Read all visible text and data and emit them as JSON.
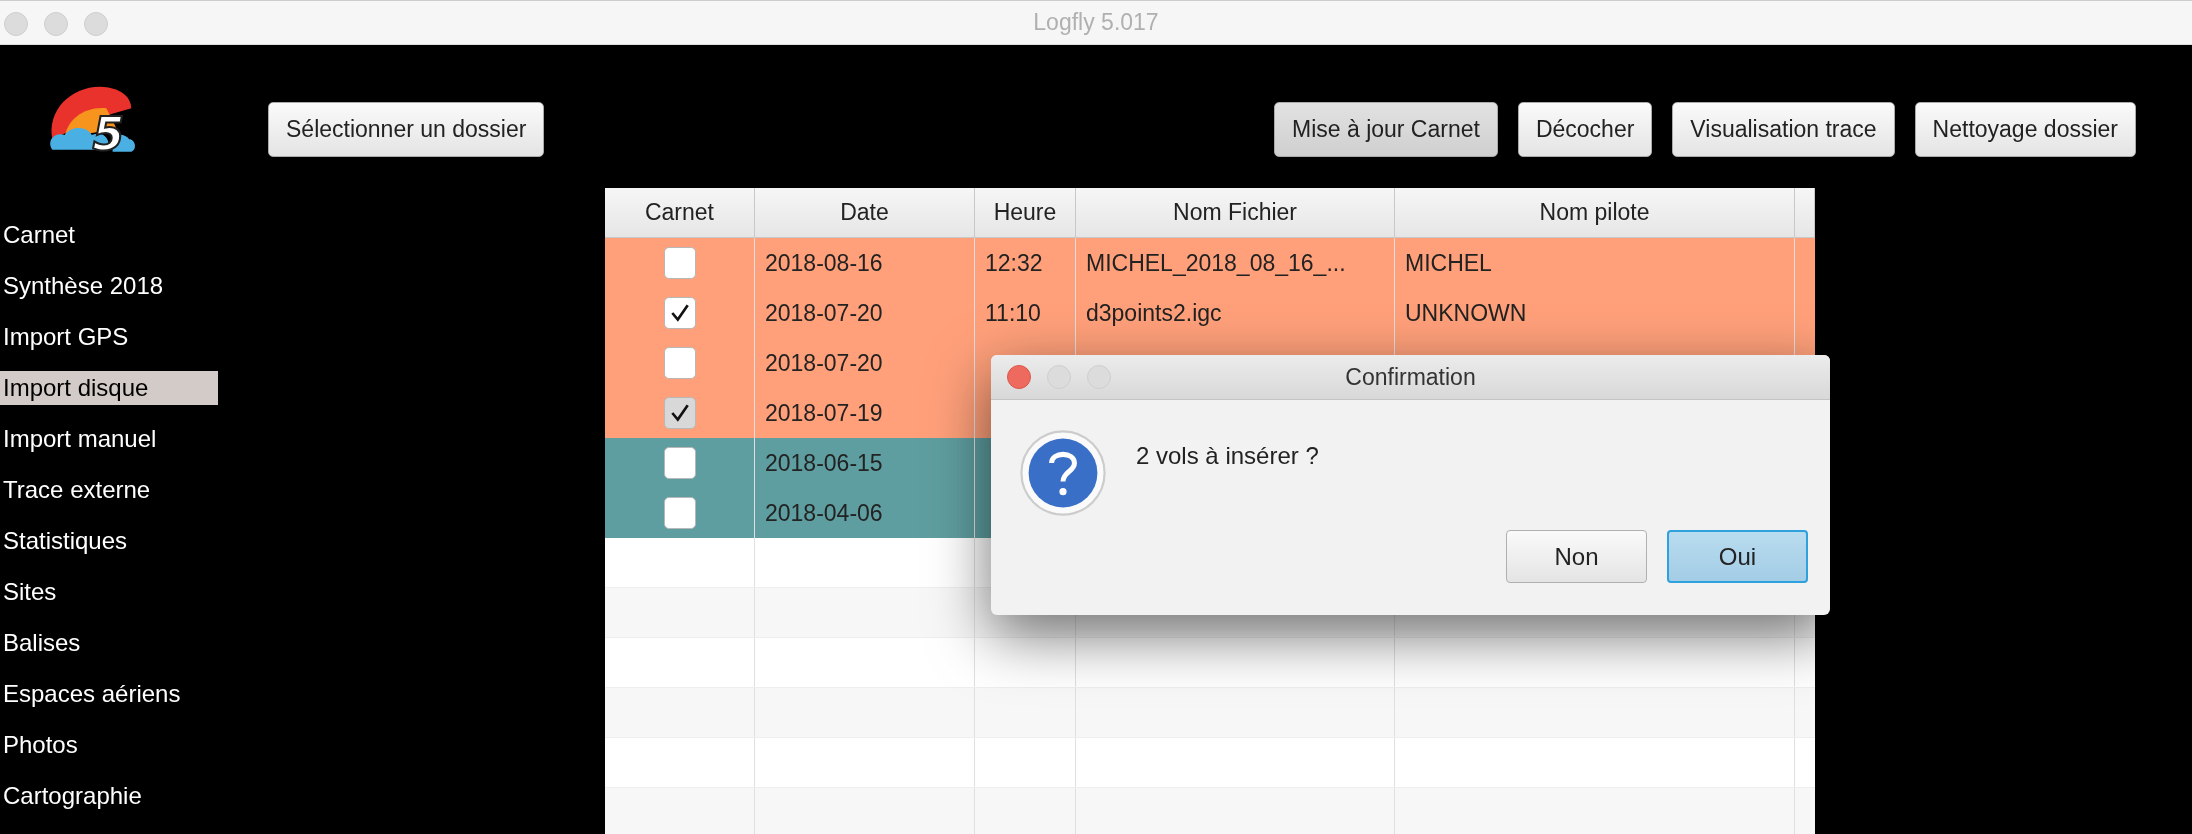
{
  "window": {
    "title": "Logfly 5.017"
  },
  "logo": {
    "text": "5"
  },
  "toolbar": {
    "left_button": {
      "label": "Sélectionner un dossier",
      "pressed": false
    },
    "right_buttons": [
      {
        "label": "Mise à jour Carnet",
        "pressed": true
      },
      {
        "label": "Décocher",
        "pressed": false
      },
      {
        "label": "Visualisation trace",
        "pressed": false
      },
      {
        "label": "Nettoyage dossier",
        "pressed": false
      }
    ]
  },
  "sidebar": {
    "items": [
      {
        "label": "Carnet",
        "selected": false
      },
      {
        "label": "Synthèse 2018",
        "selected": false
      },
      {
        "label": "Import GPS",
        "selected": false
      },
      {
        "label": "Import disque",
        "selected": true
      },
      {
        "label": "Import manuel",
        "selected": false
      },
      {
        "label": "Trace externe",
        "selected": false
      },
      {
        "label": "Statistiques",
        "selected": false
      },
      {
        "label": "Sites",
        "selected": false
      },
      {
        "label": "Balises",
        "selected": false
      },
      {
        "label": "Espaces aériens",
        "selected": false
      },
      {
        "label": "Photos",
        "selected": false
      },
      {
        "label": "Cartographie",
        "selected": false
      }
    ]
  },
  "table": {
    "columns": [
      "Carnet",
      "Date",
      "Heure",
      "Nom Fichier",
      "Nom pilote"
    ],
    "rows": [
      {
        "checked": false,
        "disabled": false,
        "color": "#ffa07a",
        "date": "2018-08-16",
        "heure": "12:32",
        "fichier": "MICHEL_2018_08_16_...",
        "pilote": "MICHEL"
      },
      {
        "checked": true,
        "disabled": false,
        "color": "#ffa07a",
        "date": "2018-07-20",
        "heure": "11:10",
        "fichier": "d3points2.igc",
        "pilote": "UNKNOWN"
      },
      {
        "checked": false,
        "disabled": false,
        "color": "#ffa07a",
        "date": "2018-07-20"
      },
      {
        "checked": true,
        "disabled": true,
        "color": "#ffa07a",
        "date": "2018-07-19"
      },
      {
        "checked": false,
        "disabled": false,
        "color": "#5f9ea0",
        "date": "2018-06-15"
      },
      {
        "checked": false,
        "disabled": false,
        "color": "#5f9ea0",
        "date": "2018-04-06"
      }
    ]
  },
  "dialog": {
    "title": "Confirmation",
    "message": "2 vols à insérer ?",
    "buttons": [
      {
        "label": "Non",
        "kind": "normal"
      },
      {
        "label": "Oui",
        "kind": "default"
      }
    ]
  }
}
